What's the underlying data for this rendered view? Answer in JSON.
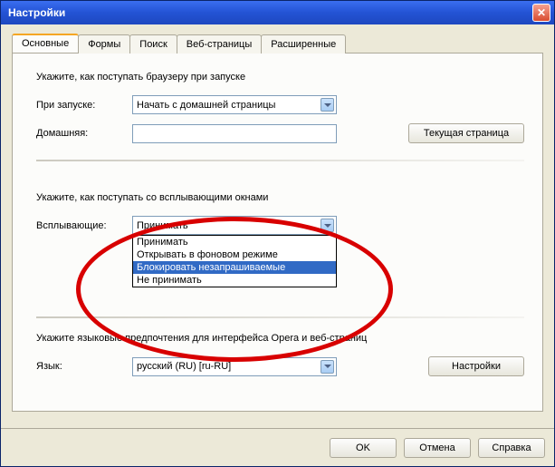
{
  "window": {
    "title": "Настройки"
  },
  "tabs": {
    "items": [
      {
        "label": "Основные"
      },
      {
        "label": "Формы"
      },
      {
        "label": "Поиск"
      },
      {
        "label": "Веб-страницы"
      },
      {
        "label": "Расширенные"
      }
    ],
    "active_index": 0
  },
  "startup": {
    "section_label": "Укажите, как поступать браузеру при запуске",
    "on_start_label": "При запуске:",
    "on_start_value": "Начать с домашней страницы",
    "home_label": "Домашняя:",
    "home_value": "",
    "current_page_button": "Текущая страница"
  },
  "popups": {
    "section_label": "Укажите, как поступать со всплывающими окнами",
    "label": "Всплывающие:",
    "value": "Принимать",
    "options": [
      "Принимать",
      "Открывать в фоновом режиме",
      "Блокировать незапрашиваемые",
      "Не принимать"
    ],
    "highlighted_index": 2
  },
  "language": {
    "section_label": "Укажите языковые предпочтения для интерфейса Opera и веб-страниц",
    "label": "Язык:",
    "value": "русский (RU) [ru-RU]",
    "settings_button": "Настройки"
  },
  "footer": {
    "ok": "OK",
    "cancel": "Отмена",
    "help": "Справка"
  }
}
